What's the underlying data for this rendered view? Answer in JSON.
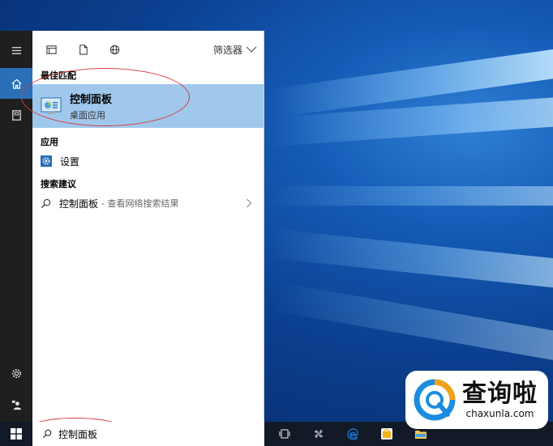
{
  "panel": {
    "filter_label": "筛选器",
    "best_match": {
      "heading": "最佳匹配",
      "title": "控制面板",
      "subtitle": "桌面应用"
    },
    "apps": {
      "heading": "应用",
      "items": [
        {
          "label": "设置",
          "icon": "gear-icon"
        }
      ]
    },
    "suggestions": {
      "heading": "搜索建议",
      "items": [
        {
          "query": "控制面板",
          "sub": "- 查看网络搜索结果"
        }
      ]
    }
  },
  "rail": {
    "icons": [
      "menu-icon",
      "home-icon",
      "notebook-icon",
      "settings-icon",
      "feedback-icon"
    ]
  },
  "taskbar": {
    "search_value": "控制面板",
    "icons": [
      "task-view-icon",
      "pinwheel-icon",
      "edge-icon",
      "store-icon",
      "file-explorer-icon"
    ]
  },
  "watermark": {
    "cn": "查询啦",
    "en": "chaxunla.com"
  },
  "colors": {
    "accent": "#2a6fb8",
    "selection": "#9fc8ec",
    "annotation": "#d83a3a"
  }
}
